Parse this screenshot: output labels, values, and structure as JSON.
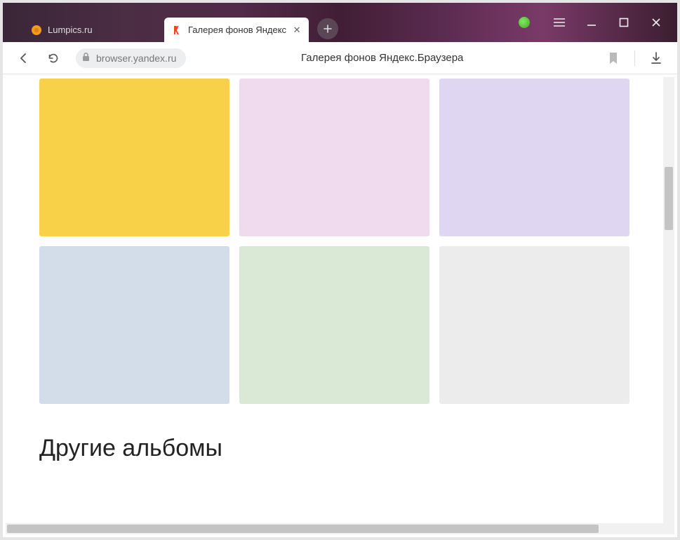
{
  "tabs": [
    {
      "title": "Lumpics.ru",
      "active": false
    },
    {
      "title": "Галерея фонов Яндекс",
      "active": true
    }
  ],
  "toolbar": {
    "url": "browser.yandex.ru",
    "page_title": "Галерея фонов Яндекс.Браузера"
  },
  "section_heading": "Другие альбомы",
  "cards": [
    {
      "color": "#f9d148"
    },
    {
      "color": "#f0daee"
    },
    {
      "color": "#dfd7f1"
    },
    {
      "color": "#d3dce9"
    },
    {
      "color": "#d9e9d6"
    },
    {
      "color": "#ececec"
    }
  ],
  "icons": {
    "lumpics_color": "#f39b1e",
    "yandex_red": "#fc3f1d"
  }
}
